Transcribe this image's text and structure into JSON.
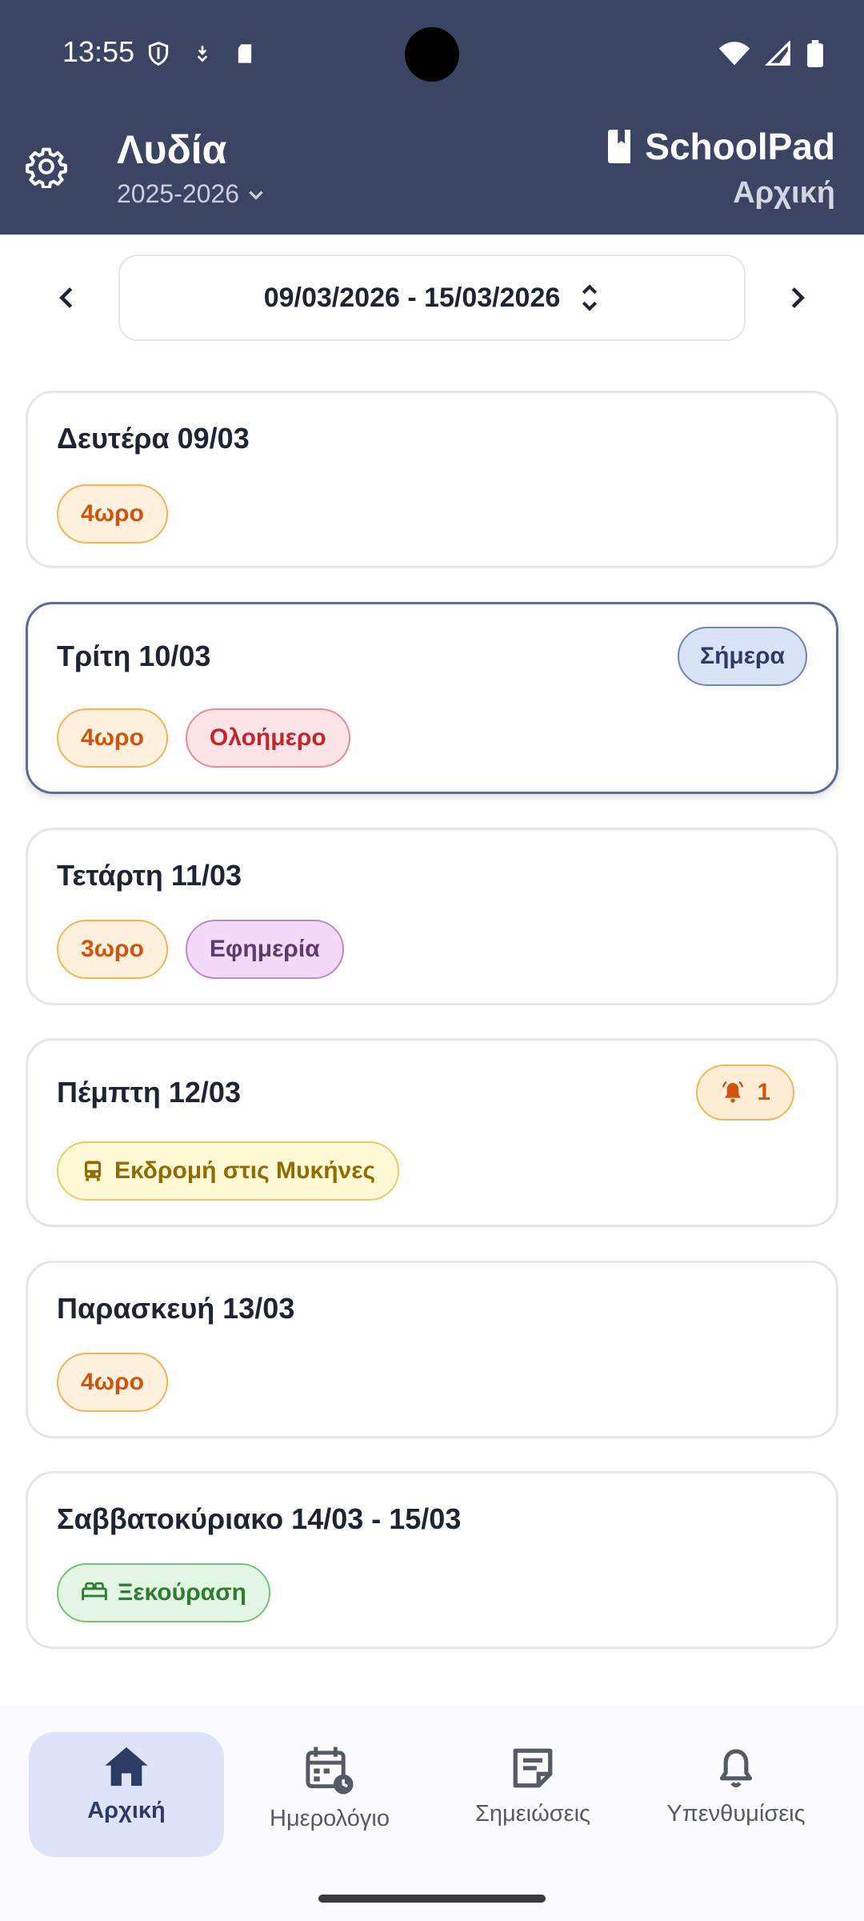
{
  "status": {
    "time": "13:55"
  },
  "header": {
    "profile_name": "Λυδία",
    "school_year": "2025-2026",
    "brand": "SchoolPad",
    "page_title": "Αρχική"
  },
  "week_nav": {
    "range": "09/03/2026 - 15/03/2026"
  },
  "days": [
    {
      "title": "Δευτέρα 09/03",
      "tags": [
        "4ωρο"
      ]
    },
    {
      "title": "Τρίτη 10/03",
      "today_badge": "Σήμερα",
      "tags": [
        "4ωρο",
        "Ολοήμερο"
      ]
    },
    {
      "title": "Τετάρτη 11/03",
      "tags": [
        "3ωρο",
        "Εφημερία"
      ]
    },
    {
      "title": "Πέμπτη 12/03",
      "reminder_count": "1",
      "tags": [
        "Εκδρομή στις Μυκήνες"
      ]
    },
    {
      "title": "Παρασκευή 13/03",
      "tags": [
        "4ωρο"
      ]
    },
    {
      "title": "Σαββατοκύριακο 14/03 - 15/03",
      "tags": [
        "Ξεκούραση"
      ]
    }
  ],
  "bottom_nav": {
    "items": [
      {
        "label": "Αρχική",
        "icon": "home-icon",
        "active": true
      },
      {
        "label": "Ημερολόγιο",
        "icon": "calendar-clock-icon",
        "active": false
      },
      {
        "label": "Σημειώσεις",
        "icon": "notes-icon",
        "active": false
      },
      {
        "label": "Υπενθυμίσεις",
        "icon": "bell-icon",
        "active": false
      }
    ]
  },
  "colors": {
    "header_bg": "#3b4463",
    "accent": "#5b6d97",
    "active_nav_bg": "#dde3fb"
  }
}
